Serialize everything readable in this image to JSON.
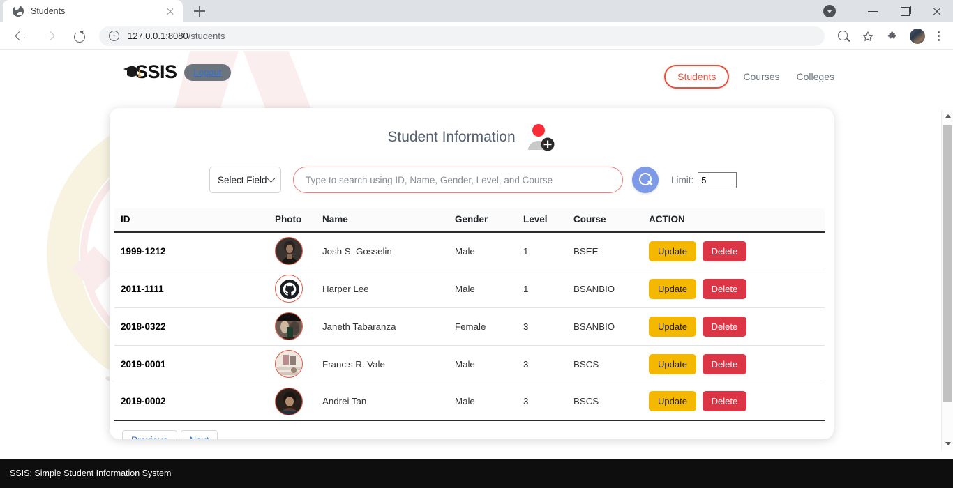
{
  "browser": {
    "tab": {
      "title": "Students",
      "favicon": "globe-icon",
      "close": "close-icon"
    },
    "new_tab": "+",
    "url_host": "127.0.0.1:8080",
    "url_path": "/students",
    "toolbar_icons": [
      "back-arrow-icon",
      "forward-arrow-icon",
      "reload-icon",
      "site-info-icon",
      "zoom-out-icon",
      "bookmark-star-icon",
      "extensions-puzzle-icon",
      "profile-avatar-icon",
      "chrome-menu-kebab-icon"
    ],
    "window_controls": [
      "download-indicator-icon",
      "minimize-icon",
      "maximize-icon",
      "close-window-icon"
    ]
  },
  "site": {
    "brand": "SSIS",
    "brand_icon": "graduation-cap-icon",
    "logout_label": "Logout",
    "nav": [
      {
        "label": "Students",
        "active": true
      },
      {
        "label": "Courses",
        "active": false
      },
      {
        "label": "Colleges",
        "active": false
      }
    ]
  },
  "card": {
    "title": "Student Information",
    "add_icon": "add-person-icon",
    "select_field": {
      "value": "Select Field",
      "chevron": "chevron-down-icon"
    },
    "search": {
      "placeholder": "Type to search using ID, Name, Gender, Level, and Course",
      "value": ""
    },
    "search_button_icon": "search-magnifier-icon",
    "limit": {
      "label": "Limit:",
      "value": "5"
    },
    "table": {
      "columns": [
        "ID",
        "Photo",
        "Name",
        "Gender",
        "Level",
        "Course",
        "ACTION"
      ],
      "rows": [
        {
          "id": "1999-1212",
          "photo": "student-photo",
          "name": "Josh S. Gosselin",
          "gender": "Male",
          "level": "1",
          "course": "BSEE",
          "update": "Update",
          "delete": "Delete"
        },
        {
          "id": "2011-1111",
          "photo": "github-logo",
          "name": "Harper Lee",
          "gender": "Male",
          "level": "1",
          "course": "BSANBIO",
          "update": "Update",
          "delete": "Delete"
        },
        {
          "id": "2018-0322",
          "photo": "student-photo",
          "name": "Janeth Tabaranza",
          "gender": "Female",
          "level": "3",
          "course": "BSANBIO",
          "update": "Update",
          "delete": "Delete"
        },
        {
          "id": "2019-0001",
          "photo": "student-photo",
          "name": "Francis R. Vale",
          "gender": "Male",
          "level": "3",
          "course": "BSCS",
          "update": "Update",
          "delete": "Delete"
        },
        {
          "id": "2019-0002",
          "photo": "student-photo",
          "name": "Andrei Tan",
          "gender": "Male",
          "level": "3",
          "course": "BSCS",
          "update": "Update",
          "delete": "Delete"
        }
      ]
    },
    "pagination": {
      "previous": "Previous",
      "next": "Next"
    }
  },
  "footer": {
    "text": "SSIS: Simple Student Information System"
  },
  "colors": {
    "accent_red": "#e8503a",
    "update_amber": "#f5b800",
    "delete_red": "#dc3545",
    "search_blue": "#7d9ae8",
    "title_slate": "#546070",
    "link_blue": "#2f6fd0",
    "footer_black": "#0e0e0e"
  }
}
